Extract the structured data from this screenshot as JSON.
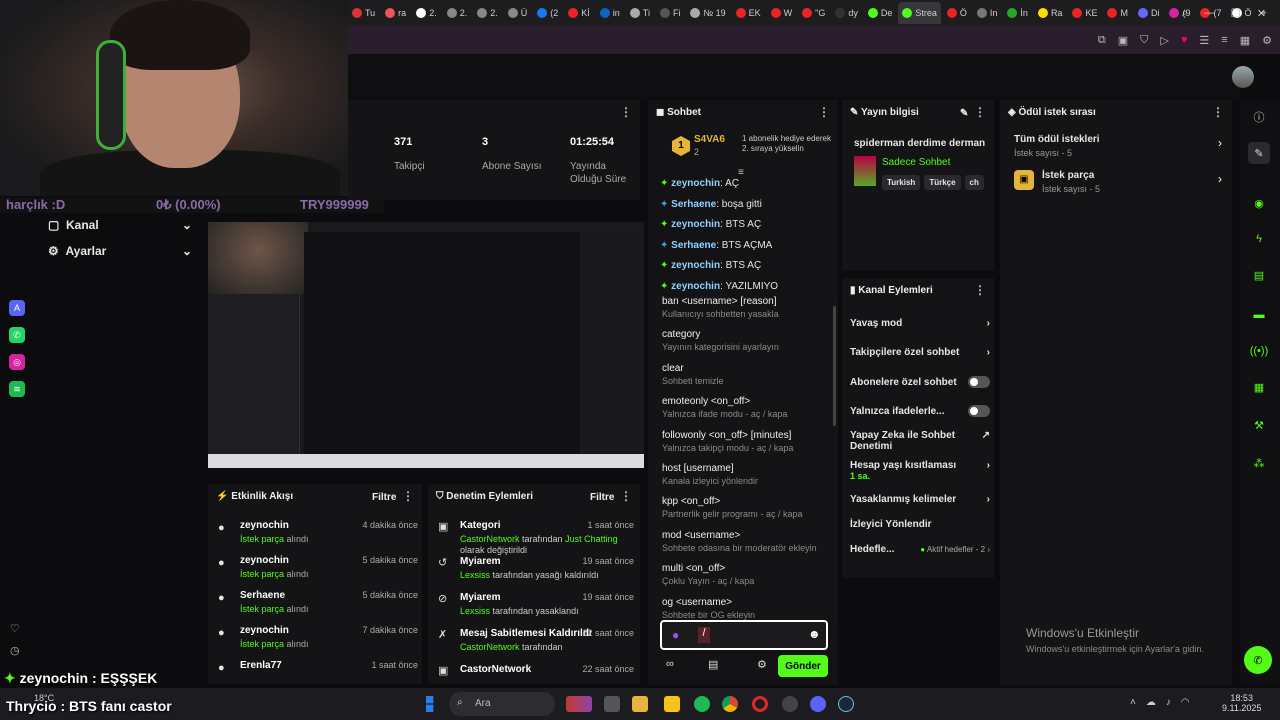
{
  "browser": {
    "tabs": [
      "Tu",
      "ra",
      "2.",
      "2.",
      "2.",
      "Ü",
      "(2",
      "Kİ",
      "in",
      "Ti",
      "Fi",
      "№ 19",
      "EK",
      "W",
      "\"G",
      "dy",
      "De",
      "Strea",
      "Ö",
      "In",
      "İn",
      "Ra",
      "KE",
      "M",
      "Di",
      "(9",
      "(7",
      "Ö"
    ],
    "active_tab": "Strea"
  },
  "overlay": {
    "donation_left": "harçlık :D",
    "donation_mid": "0₺ (0.00%)",
    "donation_right": "TRY999999",
    "chat_line1": "zeynochin : EŞŞŞEK",
    "chat_line2": "Thrycio : BTS fanı castor"
  },
  "stats": {
    "followers_value": "371",
    "followers_label": "Takipçi",
    "subs_value": "3",
    "subs_label": "Abone Sayısı",
    "uptime_value": "01:25:54",
    "uptime_label": "Yayında Olduğu Süre"
  },
  "left_nav": {
    "channel": "Kanal",
    "settings": "Ayarlar"
  },
  "events": {
    "title": "Etkinlik Akışı",
    "filter": "Filtre",
    "rows": [
      {
        "name": "zeynochin",
        "sub": "İstek parça",
        "sub2": " alındı",
        "time": "4 dakika önce"
      },
      {
        "name": "zeynochin",
        "sub": "İstek parça",
        "sub2": " alındı",
        "time": "5 dakika önce"
      },
      {
        "name": "Serhaene",
        "sub": "İstek parça",
        "sub2": " alındı",
        "time": "5 dakika önce"
      },
      {
        "name": "zeynochin",
        "sub": "İstek parça",
        "sub2": " alındı",
        "time": "7 dakika önce"
      },
      {
        "name": "Erenla77",
        "sub": "",
        "sub2": "",
        "time": "1 saat önce"
      }
    ]
  },
  "moderation": {
    "title": "Denetim Eylemleri",
    "filter": "Filtre",
    "rows": [
      {
        "name": "Kategori",
        "time": "1 saat önce",
        "who": "CastorNetwork",
        "mid": " tarafından ",
        "val": "Just Chatting",
        "end": " olarak değiştirildi"
      },
      {
        "name": "Myiarem",
        "time": "19 saat önce",
        "who": "Lexsiss",
        "mid": " tarafından yasağı kaldırıldı",
        "val": "",
        "end": ""
      },
      {
        "name": "Myiarem",
        "time": "19 saat önce",
        "who": "Lexsiss",
        "mid": " tarafından yasaklandı",
        "val": "",
        "end": ""
      },
      {
        "name": "Mesaj Sabitlemesi Kaldırıldı",
        "time": "22 saat önce",
        "who": "CastorNetwork",
        "mid": " tarafından",
        "val": "",
        "end": ""
      },
      {
        "name": "CastorNetwork",
        "time": "22 saat önce",
        "who": "",
        "mid": "",
        "val": "",
        "end": ""
      }
    ]
  },
  "chat": {
    "title": "Sohbet",
    "pinned_user": "S4VA6",
    "pinned_count": "2",
    "pinned_text": "1 abonelik hediye ederek 2. sıraya yükselin",
    "messages": [
      {
        "user": "zeynochin",
        "text": ": AÇ"
      },
      {
        "user": "Serhaene",
        "text": ": boşa gitti"
      },
      {
        "user": "zeynochin",
        "text": ": BTS AÇ"
      },
      {
        "user": "Serhaene",
        "text": ": BTS AÇMA"
      },
      {
        "user": "zeynochin",
        "text": ": BTS AÇ"
      },
      {
        "user": "zeynochin",
        "text": ": YAZILMIYO"
      }
    ],
    "commands": [
      {
        "cmd": "ban <username> [reason]",
        "desc": "Kullanıcıyı sohbetten yasakla"
      },
      {
        "cmd": "category",
        "desc": "Yayının kategorisini ayarlayın"
      },
      {
        "cmd": "clear",
        "desc": "Sohbeti temizle"
      },
      {
        "cmd": "emoteonly <on_off>",
        "desc": "Yalnızca ifade modu - aç / kapa"
      },
      {
        "cmd": "followonly <on_off> [minutes]",
        "desc": "Yalnızca takipçi modu - aç / kapa"
      },
      {
        "cmd": "host [username]",
        "desc": "Kanala izleyici yönlendir"
      },
      {
        "cmd": "kpp <on_off>",
        "desc": "Partnerlik gelir programı - aç / kapa"
      },
      {
        "cmd": "mod <username>",
        "desc": "Sohbete odasına bir moderatör ekleyin"
      },
      {
        "cmd": "multi <on_off>",
        "desc": "Çoklu Yayın - aç / kapa"
      },
      {
        "cmd": "og <username>",
        "desc": "Sohbete bir OG ekleyin"
      }
    ],
    "input_value": "/",
    "send_label": "Gönder"
  },
  "stream_info": {
    "title": "Yayın bilgisi",
    "stream_title": "spiderman derdime derman",
    "category": "Sadece Sohbet",
    "tags": [
      "Turkish",
      "Türkçe",
      "ch"
    ]
  },
  "actions": {
    "title": "Kanal Eylemleri",
    "items": {
      "slow": "Yavaş mod",
      "followers": "Takipçilere özel sohbet",
      "subs": "Abonelere özel sohbet",
      "emotes": "Yalnızca ifadelerle...",
      "ai1": "Yapay Zeka ile Sohbet",
      "ai2": "Denetimi",
      "age": "Hesap yaşı kısıtlaması",
      "age_val": "1 sa.",
      "banned": "Yasaklanmış kelimeler",
      "redirect": "İzleyici Yönlendir",
      "goals": "Hedefle...",
      "goals_val": "Aktif hedefler - 2"
    }
  },
  "rewards": {
    "title": "Ödül istek sırası",
    "all_title": "Tüm ödül istekleri",
    "all_count": "İstek sayısı - 5",
    "song_title": "İstek parça",
    "song_count": "İstek sayısı - 5"
  },
  "watermark": {
    "line1": "Windows'u Etkinleştir",
    "line2": "Windows'u etkinleştirmek için Ayarlar'a gidin."
  },
  "taskbar": {
    "weather": "18°C",
    "search": "Ara",
    "time": "18:53",
    "date": "9.11.2025"
  },
  "colors": {
    "accent": "#53fc18",
    "bg": "#0c0c0e",
    "panel": "#141416"
  }
}
